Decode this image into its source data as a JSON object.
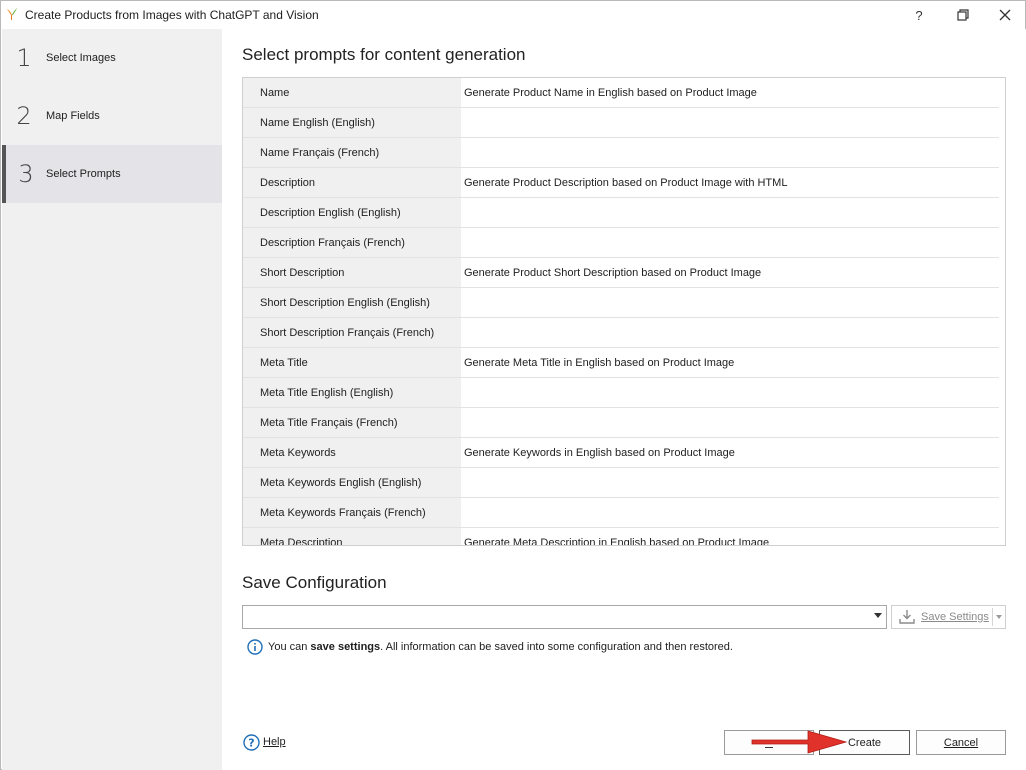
{
  "window": {
    "title": "Create Products from Images with ChatGPT and Vision",
    "help_glyph": "?",
    "restore_glyph": "❐",
    "close_glyph": "✕"
  },
  "sidebar": {
    "steps": [
      {
        "number": "1",
        "label": "Select Images"
      },
      {
        "number": "2",
        "label": "Map Fields"
      },
      {
        "number": "3",
        "label": "Select Prompts"
      }
    ]
  },
  "prompts": {
    "title": "Select prompts for content generation",
    "rows": [
      {
        "name": "Name",
        "prompt": "Generate Product Name in English based on Product Image"
      },
      {
        "name": "Name English (English)",
        "prompt": ""
      },
      {
        "name": "Name Français (French)",
        "prompt": ""
      },
      {
        "name": "Description",
        "prompt": "Generate Product Description based on Product Image with HTML"
      },
      {
        "name": "Description English (English)",
        "prompt": ""
      },
      {
        "name": "Description Français (French)",
        "prompt": ""
      },
      {
        "name": "Short Description",
        "prompt": "Generate Product Short Description based on Product Image"
      },
      {
        "name": "Short Description English (English)",
        "prompt": ""
      },
      {
        "name": "Short Description Français (French)",
        "prompt": ""
      },
      {
        "name": "Meta Title",
        "prompt": "Generate Meta Title in English based on Product Image"
      },
      {
        "name": "Meta Title English (English)",
        "prompt": ""
      },
      {
        "name": "Meta Title Français (French)",
        "prompt": ""
      },
      {
        "name": "Meta Keywords",
        "prompt": "Generate Keywords in English based on Product Image"
      },
      {
        "name": "Meta Keywords English (English)",
        "prompt": ""
      },
      {
        "name": "Meta Keywords Français (French)",
        "prompt": ""
      },
      {
        "name": "Meta Description",
        "prompt": "Generate Meta Description in English based on Product Image"
      }
    ]
  },
  "config": {
    "title": "Save Configuration",
    "combo_value": "",
    "save_settings_label": "Save Settings",
    "info_prefix": "You can ",
    "info_bold": "save settings",
    "info_suffix": ". All information can be saved into some configuration and then restored."
  },
  "footer": {
    "help_label": "Help",
    "create_label": "Create",
    "cancel_label": "Cancel"
  },
  "colors": {
    "accent_info": "#1f6fb8",
    "annotation_arrow": "#e0312b"
  }
}
